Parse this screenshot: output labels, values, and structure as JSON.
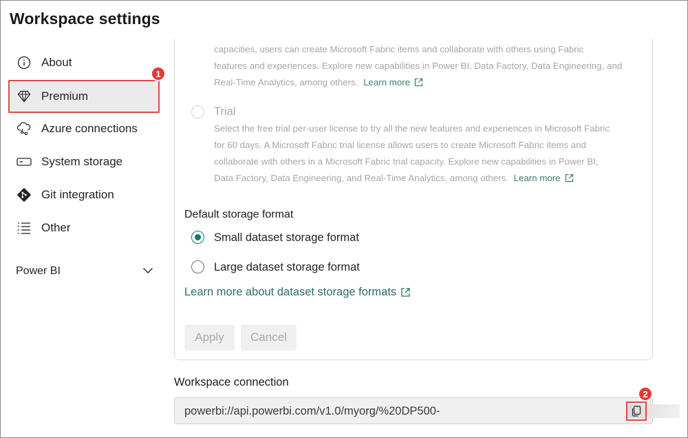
{
  "window": {
    "title": "Workspace settings"
  },
  "sidebar": {
    "items": [
      {
        "label": "About",
        "icon": "info-icon"
      },
      {
        "label": "Premium",
        "icon": "diamond-icon",
        "selected": true
      },
      {
        "label": "Azure connections",
        "icon": "cloud-network-icon"
      },
      {
        "label": "System storage",
        "icon": "storage-drive-icon"
      },
      {
        "label": "Git integration",
        "icon": "git-icon"
      },
      {
        "label": "Other",
        "icon": "list-icon"
      }
    ],
    "section": {
      "label": "Power BI",
      "icon": "chevron-down-icon"
    }
  },
  "annotations": {
    "badge1": "1",
    "badge2": "2"
  },
  "license": {
    "fabric_text_lines": [
      "capacities, users can create Microsoft Fabric items and collaborate with others using Fabric",
      "features and experiences. Explore new capabilities in Power BI, Data Factory, Data Engineering, and",
      "Real-Time Analytics, among others."
    ],
    "fabric_learn_more": "Learn more",
    "trial_label": "Trial",
    "trial_text_lines": [
      "Select the free trial per-user license to try all the new features and experiences in Microsoft Fabric",
      "for 60 days. A Microsoft Fabric trial license allows users to create Microsoft Fabric items and",
      "collaborate with others in a Microsoft Fabric trial capacity. Explore new capabilities in Power BI,",
      "Data Factory, Data Engineering, and Real-Time Analytics, among others."
    ],
    "trial_learn_more": "Learn more"
  },
  "storage": {
    "heading": "Default storage format",
    "options": [
      {
        "label": "Small dataset storage format",
        "checked": true
      },
      {
        "label": "Large dataset storage format",
        "checked": false
      }
    ],
    "learn_more": "Learn more about dataset storage formats"
  },
  "buttons": {
    "apply": "Apply",
    "cancel": "Cancel"
  },
  "connection": {
    "heading": "Workspace connection",
    "value": "powerbi://api.powerbi.com/v1.0/myorg/%20DP500-",
    "copy_icon": "copy-icon"
  },
  "colors": {
    "accent": "#117865",
    "annotation": "#e03c37",
    "link": "#2b6e66"
  }
}
